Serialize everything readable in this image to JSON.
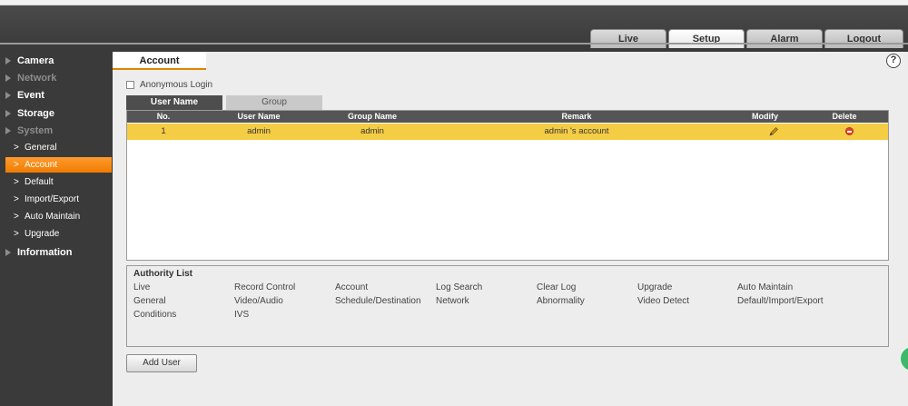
{
  "nav": {
    "tabs": [
      {
        "label": "Live",
        "active": false
      },
      {
        "label": "Setup",
        "active": true
      },
      {
        "label": "Alarm",
        "active": false
      },
      {
        "label": "Logout",
        "active": false
      }
    ]
  },
  "sidebar": {
    "main_items": [
      {
        "label": "Camera"
      },
      {
        "label": "Network"
      },
      {
        "label": "Event"
      },
      {
        "label": "Storage"
      },
      {
        "label": "System"
      },
      {
        "label": "Information"
      }
    ],
    "system_items": [
      {
        "label": "General"
      },
      {
        "label": "Account"
      },
      {
        "label": "Default"
      },
      {
        "label": "Import/Export"
      },
      {
        "label": "Auto Maintain"
      },
      {
        "label": "Upgrade"
      }
    ],
    "active_item": "Account"
  },
  "page": {
    "tab_label": "Account",
    "help_label": "?",
    "anonymous_login_label": "Anonymous Login",
    "anonymous_login_checked": false,
    "subtabs": [
      {
        "label": "User Name",
        "active": true
      },
      {
        "label": "Group",
        "active": false
      }
    ]
  },
  "table": {
    "columns": [
      "No.",
      "User Name",
      "Group Name",
      "Remark",
      "Modify",
      "Delete"
    ],
    "rows": [
      {
        "no": "1",
        "user_name": "admin",
        "group_name": "admin",
        "remark": "admin 's account",
        "selected": true
      }
    ]
  },
  "authority": {
    "title": "Authority List",
    "items": [
      "Live",
      "Record Control",
      "Account",
      "Log Search",
      "Clear Log",
      "Upgrade",
      "Auto Maintain",
      "General",
      "Video/Audio",
      "Schedule/Destination",
      "Network",
      "Abnormality",
      "Video Detect",
      "Default/Import/Export",
      "Conditions",
      "IVS"
    ]
  },
  "buttons": {
    "add_user": "Add User"
  },
  "colors": {
    "accent_orange": "#f07c00",
    "selected_row": "#f4cd45",
    "table_header": "#555555",
    "delete_red": "#e0452c"
  }
}
